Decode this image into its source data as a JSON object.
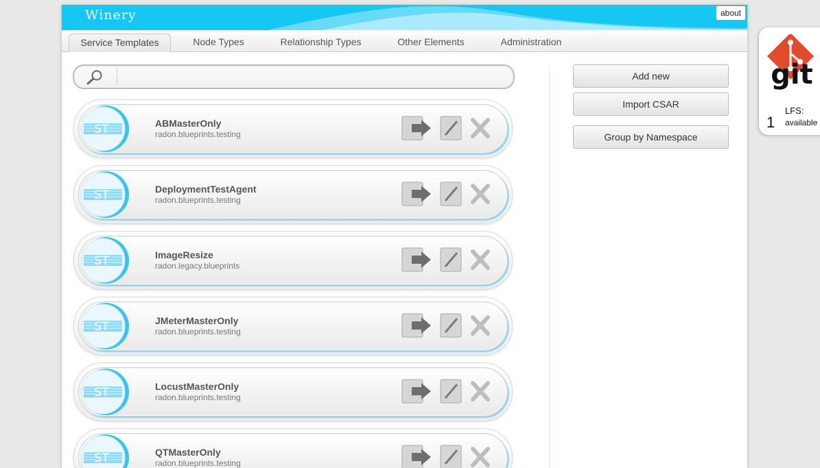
{
  "header": {
    "brand": "Winery",
    "about_label": "about"
  },
  "nav": {
    "tabs": [
      {
        "label": "Service Templates",
        "active": true
      },
      {
        "label": "Node Types",
        "active": false
      },
      {
        "label": "Relationship Types",
        "active": false
      },
      {
        "label": "Other Elements",
        "active": false
      },
      {
        "label": "Administration",
        "active": false
      }
    ]
  },
  "search": {
    "value": "",
    "placeholder": ""
  },
  "actions": {
    "add_new": "Add new",
    "import_csar": "Import CSAR",
    "group_by_namespace": "Group by Namespace"
  },
  "items": [
    {
      "badge": "ST",
      "name": "ABMasterOnly",
      "namespace": "radon.blueprints.testing"
    },
    {
      "badge": "ST",
      "name": "DeploymentTestAgent",
      "namespace": "radon.blueprints.testing"
    },
    {
      "badge": "ST",
      "name": "ImageResize",
      "namespace": "radon.legacy.blueprints"
    },
    {
      "badge": "ST",
      "name": "JMeterMasterOnly",
      "namespace": "radon.blueprints.testing"
    },
    {
      "badge": "ST",
      "name": "LocustMasterOnly",
      "namespace": "radon.blueprints.testing"
    },
    {
      "badge": "ST",
      "name": "QTMasterOnly",
      "namespace": "radon.blueprints.testing"
    }
  ],
  "git": {
    "logo_text": "git",
    "count": "1",
    "lfs_label": "LFS:",
    "lfs_status": "available"
  },
  "icons": {
    "search": "magnifier-icon",
    "export": "export-arrow-icon",
    "edit": "pencil-icon",
    "delete": "x-icon"
  },
  "colors": {
    "header_blue": "#16c6f3",
    "accent_blue": "#39c4f0",
    "git_red": "#e24b2c"
  }
}
